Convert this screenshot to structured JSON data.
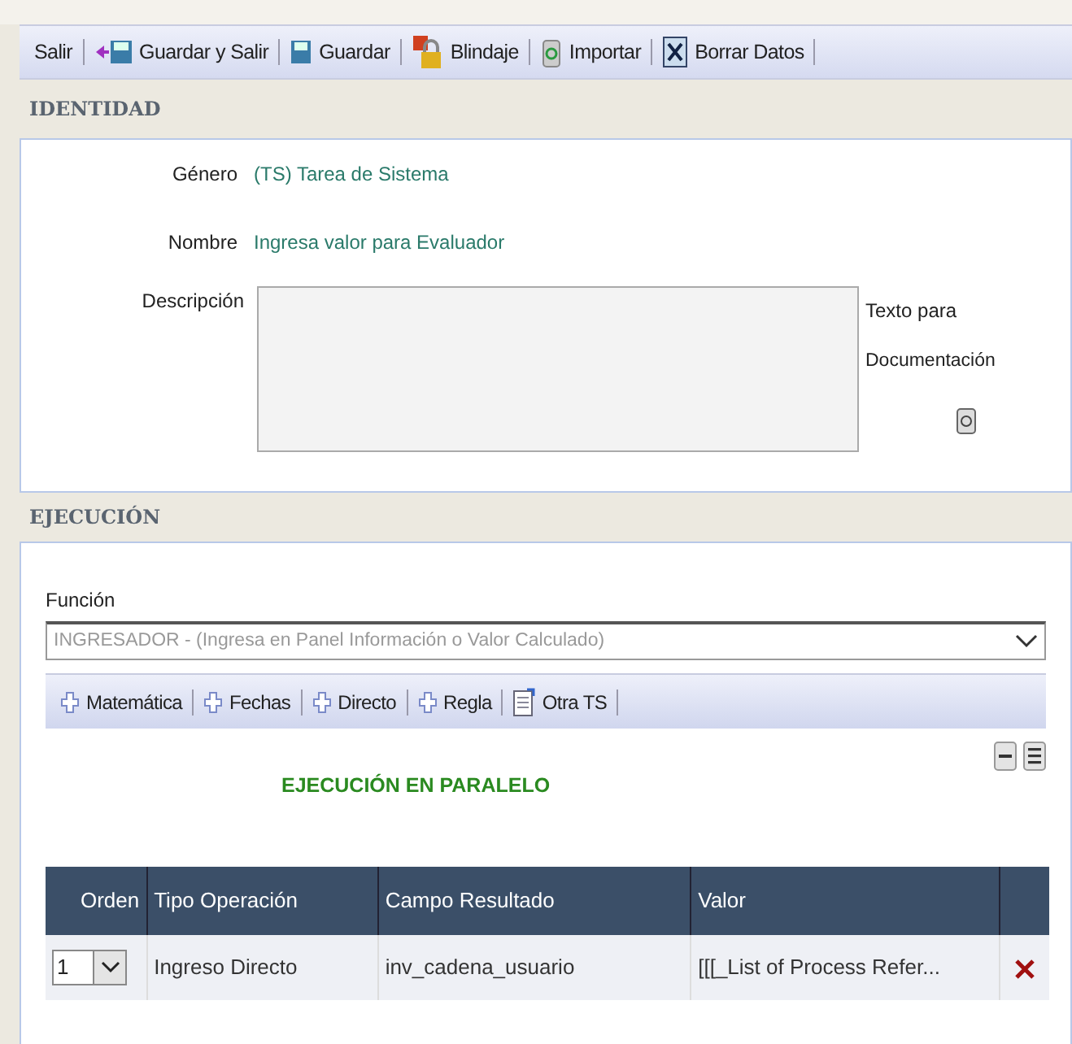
{
  "toolbar": [
    {
      "label": "Salir",
      "kind": "plain"
    },
    {
      "label": "Guardar y Salir",
      "kind": "save-exit"
    },
    {
      "label": "Guardar",
      "kind": "save"
    },
    {
      "label": "Blindaje",
      "kind": "lock"
    },
    {
      "label": "Importar",
      "kind": "import"
    },
    {
      "label": "Borrar Datos",
      "kind": "clear"
    }
  ],
  "identidad": {
    "title": "IDENTIDAD",
    "genero_label": "Género",
    "genero_value": "(TS) Tarea de Sistema",
    "nombre_label": "Nombre",
    "nombre_value": "Ingresa valor para Evaluador",
    "descripcion_label": "Descripción",
    "doc_label_1": "Texto para",
    "doc_label_2": "Documentación"
  },
  "ejecucion": {
    "title": "EJECUCIÓN",
    "funcion_label": "Función",
    "funcion_value": "INGRESADOR - (Ingresa en Panel Información o Valor Calculado)",
    "toolbar": [
      {
        "label": "Matemática",
        "kind": "add"
      },
      {
        "label": "Fechas",
        "kind": "add"
      },
      {
        "label": "Directo",
        "kind": "add"
      },
      {
        "label": "Regla",
        "kind": "add"
      },
      {
        "label": "Otra TS",
        "kind": "doc"
      }
    ],
    "parallel_title": "EJECUCIÓN EN PARALELO",
    "table": {
      "columns": [
        "Orden",
        "Tipo Operación",
        "Campo Resultado",
        "Valor"
      ],
      "rows": [
        {
          "orden": "1",
          "tipo": "Ingreso Directo",
          "campo": "inv_cadena_usuario",
          "valor": "[[[_List of Process Refer..."
        }
      ]
    }
  }
}
